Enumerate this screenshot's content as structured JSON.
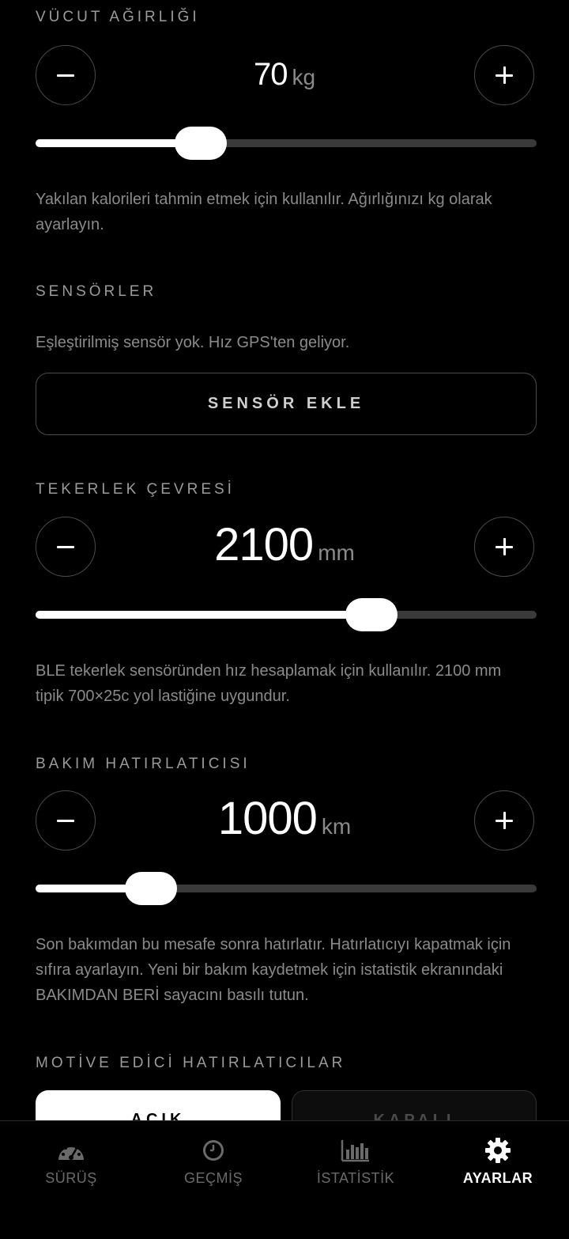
{
  "body_weight": {
    "title": "VÜCUT AĞIRLIĞI",
    "value": "70",
    "unit": "kg",
    "slider_level": 0.33,
    "description": "Yakılan kalorileri tahmin etmek için kullanılır. Ağırlığınızı kg olarak ayarlayın."
  },
  "sensors": {
    "title": "SENSÖRLER",
    "description": "Eşleştirilmiş sensör yok. Hız GPS'ten geliyor.",
    "add_button": "SENSÖR EKLE"
  },
  "wheel": {
    "title": "TEKERLEK ÇEVRESİ",
    "value": "2100",
    "unit": "mm",
    "slider_level": 0.67,
    "description": "BLE tekerlek sensöründen hız hesaplamak için kullanılır. 2100 mm tipik 700×25c yol lastiğine uygundur."
  },
  "maintenance": {
    "title": "BAKIM HATIRLATICISI",
    "value": "1000",
    "unit": "km",
    "slider_level": 0.23,
    "description": "Son bakımdan bu mesafe sonra hatırlatır. Hatırlatıcıyı kapatmak için sıfıra ayarlayın. Yeni bir bakım kaydetmek için istatistik ekranındaki BAKIMDAN BERİ sayacını basılı tutun."
  },
  "motivation": {
    "title": "MOTİVE EDİCİ HATIRLATICILAR",
    "on_label": "AÇIK",
    "off_label": "KAPALI"
  },
  "nav": {
    "items": [
      {
        "label": "SÜRÜŞ",
        "icon": "speedometer-icon",
        "active": false
      },
      {
        "label": "GEÇMİŞ",
        "icon": "clock-icon",
        "active": false
      },
      {
        "label": "İSTATİSTİK",
        "icon": "bar-chart-icon",
        "active": false
      },
      {
        "label": "AYARLAR",
        "icon": "gear-icon",
        "active": true
      }
    ]
  },
  "colors": {
    "background": "#000000",
    "muted_text": "#8a8a8a",
    "active": "#ffffff"
  }
}
